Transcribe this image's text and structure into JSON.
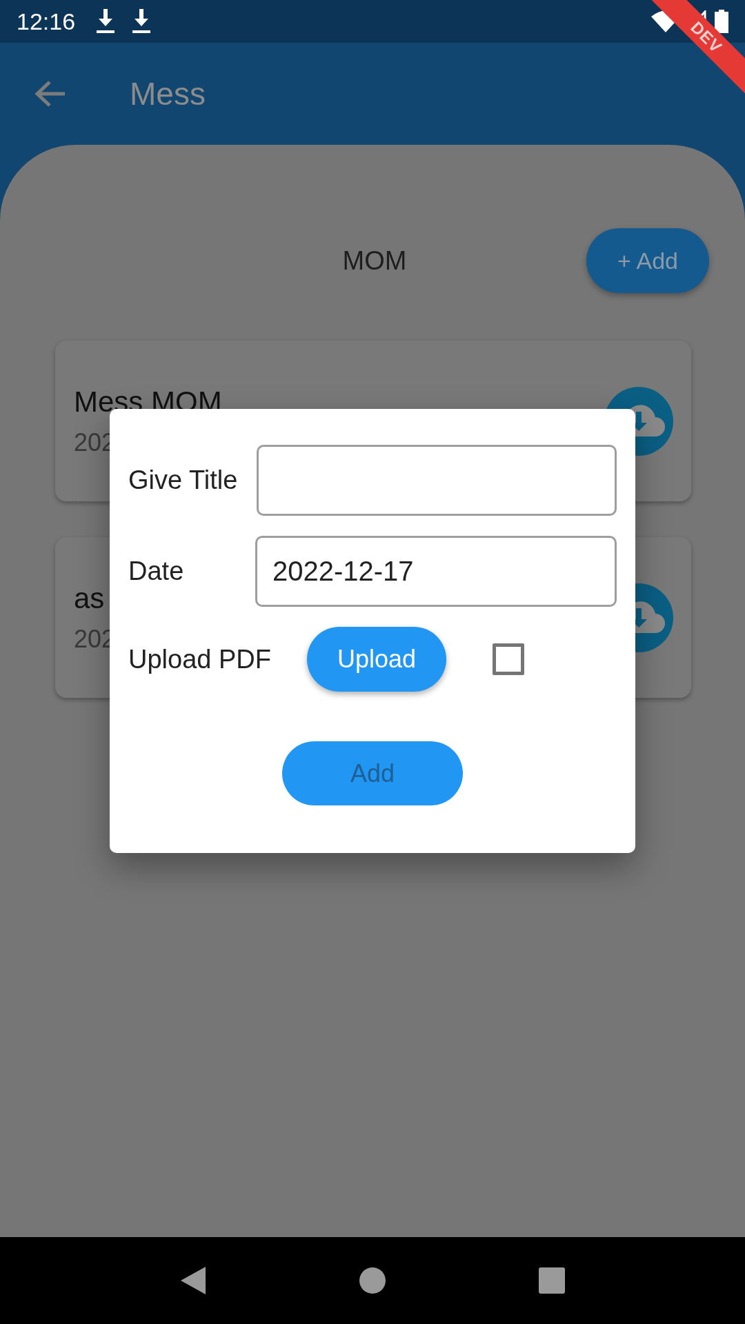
{
  "status_bar": {
    "time": "12:16",
    "banner": "DEV"
  },
  "app_bar": {
    "title": "Mess"
  },
  "section": {
    "title": "MOM",
    "add_button": "+ Add"
  },
  "cards": [
    {
      "title": "Mess MOM",
      "subtitle": "202"
    },
    {
      "title": "as",
      "subtitle": "202"
    }
  ],
  "dialog": {
    "fields": [
      {
        "label": "Give Title"
      },
      {
        "label": "Date",
        "value": "2022-12-17"
      }
    ],
    "upload": {
      "label": "Upload PDF",
      "button": "Upload",
      "checked": false
    },
    "submit": "Add"
  }
}
